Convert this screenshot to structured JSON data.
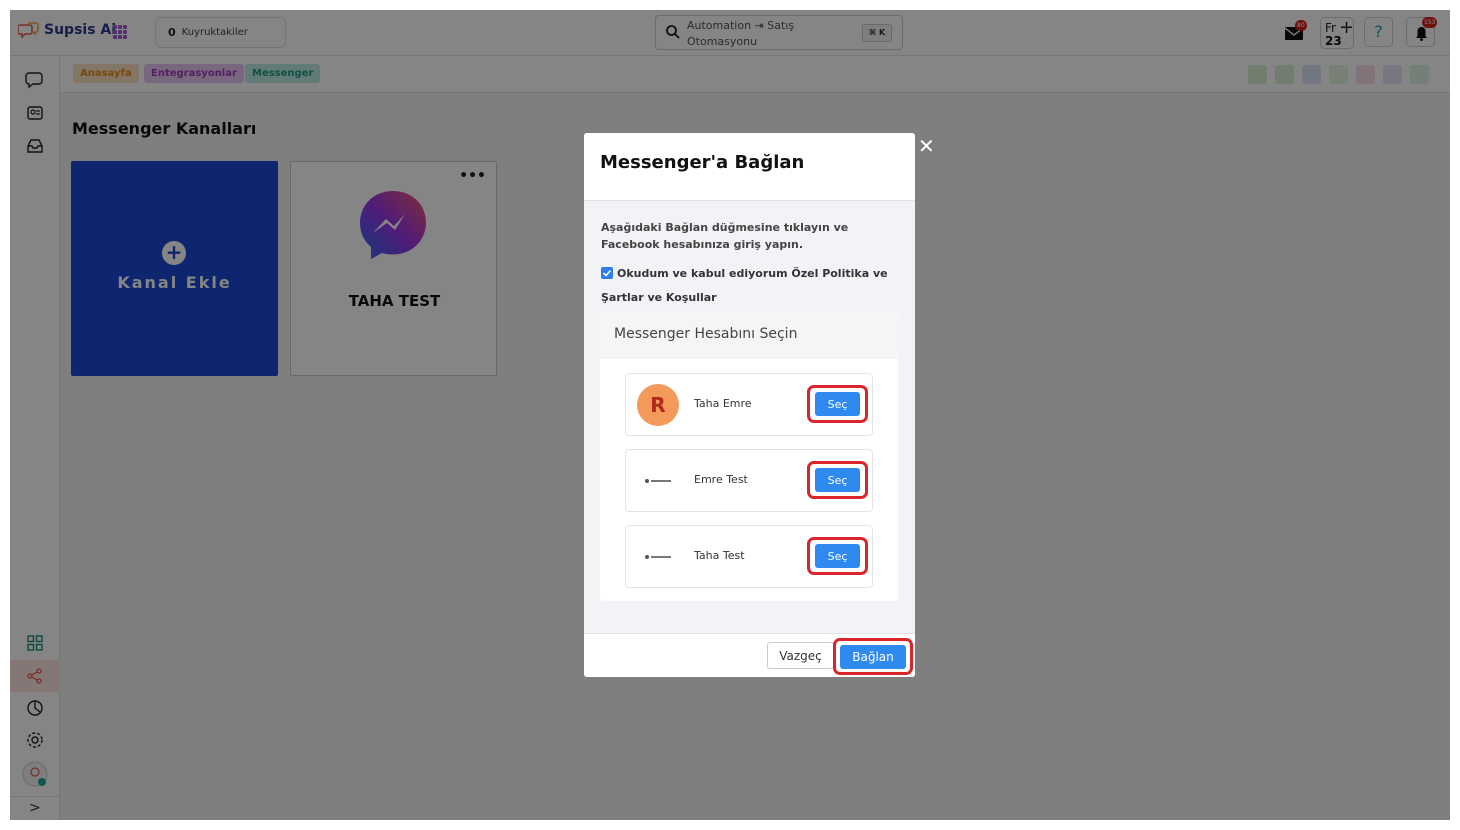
{
  "app": {
    "name": "Supsis Ai",
    "queue_count": "0",
    "queue_label": "Kuyruktakiler",
    "search_placeholder": "Automation ⇥ Satış Otomasyonu",
    "search_shortcut": "⌘ K",
    "mail_badge": "80",
    "bell_badge": "153",
    "day_abbr": "Fr",
    "day_number": "23",
    "help_glyph": "?"
  },
  "breadcrumb": [
    "Anasayfa",
    "Entegrasyonlar",
    "Messenger"
  ],
  "page": {
    "title": "Messenger Kanalları",
    "add_channel_label": "Kanal Ekle",
    "channel_name": "TAHA TEST",
    "more_glyph": "•••"
  },
  "modal": {
    "title": "Messenger'a Bağlan",
    "description": "Aşağıdaki Bağlan düğmesine tıklayın ve Facebook hesabınıza giriş yapın.",
    "agree_text": "Okudum ve kabul ediyorum Özel Politika ve Şartlar ve Koşullar",
    "agree_checked": true,
    "account_section_title": "Messenger Hesabını Seçin",
    "accounts": [
      {
        "name": "Taha Emre",
        "avatar_letter": "R",
        "select_label": "Seç"
      },
      {
        "name": "Emre Test",
        "avatar_letter": "",
        "select_label": "Seç"
      },
      {
        "name": "Taha Test",
        "avatar_letter": "",
        "select_label": "Seç"
      }
    ],
    "cancel_label": "Vazgeç",
    "connect_label": "Bağlan",
    "close_glyph": "✕"
  },
  "colors": {
    "primary_button": "#2f8af0",
    "add_card": "#1c48d6",
    "highlight_ring": "#d8262a",
    "avatar_orange": "#f39a5a"
  }
}
